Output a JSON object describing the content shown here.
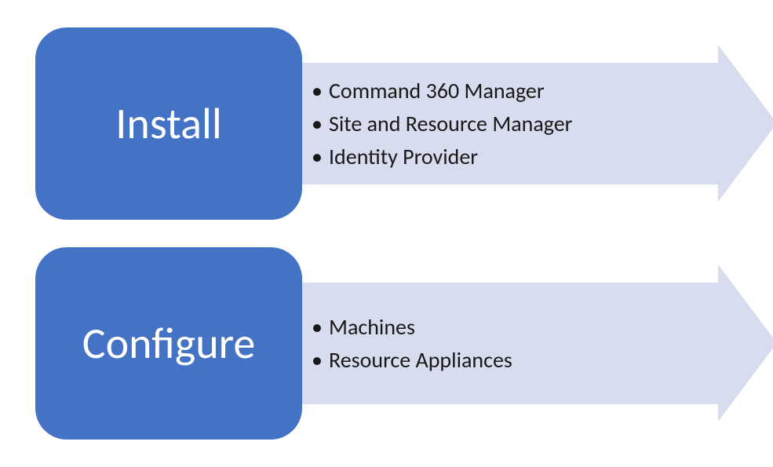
{
  "rows": [
    {
      "title": "Install",
      "items": [
        "Command 360 Manager",
        "Site and Resource Manager",
        "Identity Provider"
      ]
    },
    {
      "title": "Configure",
      "items": [
        "Machines",
        "Resource Appliances"
      ]
    }
  ],
  "colors": {
    "boxFill": "#4472c4",
    "arrowFill": "#d7dcee",
    "boxText": "#ffffff",
    "itemText": "#191919"
  }
}
